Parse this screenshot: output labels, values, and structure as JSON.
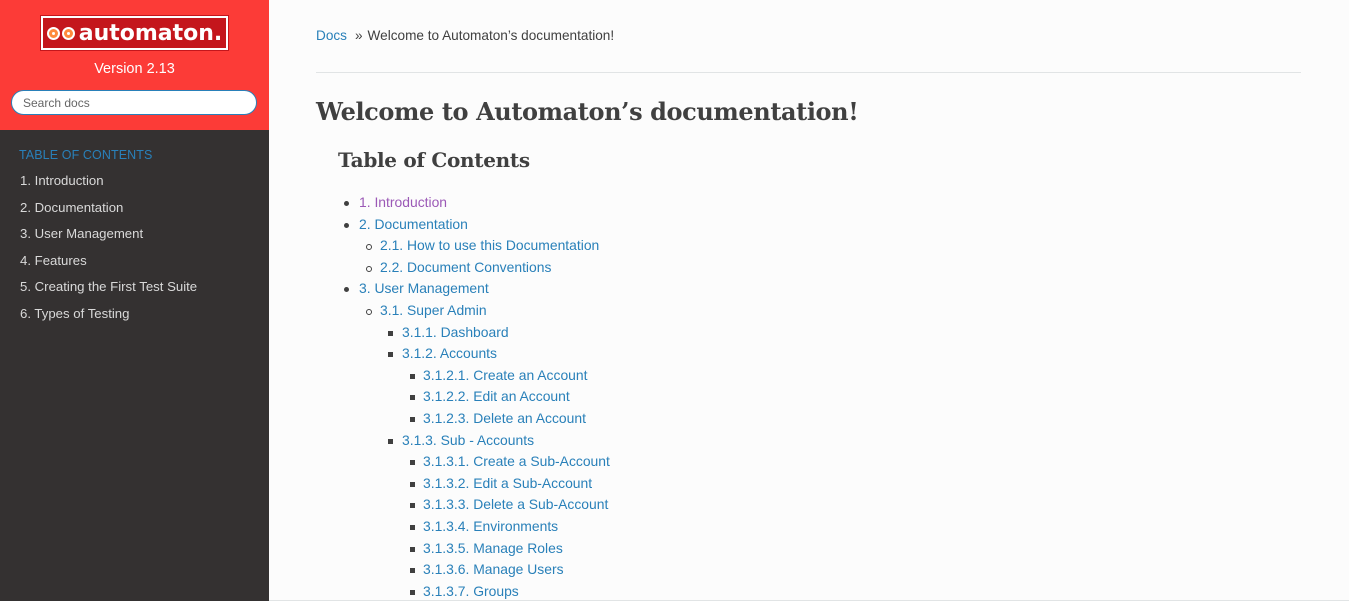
{
  "sidebar": {
    "logo_text": "automaton.",
    "version": "Version 2.13",
    "search_placeholder": "Search docs",
    "caption": "TABLE OF CONTENTS",
    "items": [
      {
        "label": "1. Introduction"
      },
      {
        "label": "2. Documentation"
      },
      {
        "label": "3. User Management"
      },
      {
        "label": "4. Features"
      },
      {
        "label": "5. Creating the First Test Suite"
      },
      {
        "label": "6. Types of Testing"
      }
    ]
  },
  "breadcrumb": {
    "home": "Docs",
    "separator": "»",
    "current": "Welcome to Automaton’s documentation!"
  },
  "page_title": "Welcome to Automaton’s documentation!",
  "toc_title": "Table of Contents",
  "toc": [
    {
      "label": "1. Introduction",
      "level": 1,
      "visited": true
    },
    {
      "label": "2. Documentation",
      "level": 1
    },
    {
      "label": "2.1. How to use this Documentation",
      "level": 2
    },
    {
      "label": "2.2. Document Conventions",
      "level": 2
    },
    {
      "label": "3. User Management",
      "level": 1
    },
    {
      "label": "3.1. Super Admin",
      "level": 2
    },
    {
      "label": "3.1.1. Dashboard",
      "level": 3
    },
    {
      "label": "3.1.2. Accounts",
      "level": 3
    },
    {
      "label": "3.1.2.1. Create an Account",
      "level": 4
    },
    {
      "label": "3.1.2.2. Edit an Account",
      "level": 4
    },
    {
      "label": "3.1.2.3. Delete an Account",
      "level": 4
    },
    {
      "label": "3.1.3. Sub - Accounts",
      "level": 3
    },
    {
      "label": "3.1.3.1. Create a Sub-Account",
      "level": 4
    },
    {
      "label": "3.1.3.2. Edit a Sub-Account",
      "level": 4
    },
    {
      "label": "3.1.3.3. Delete a Sub-Account",
      "level": 4
    },
    {
      "label": "3.1.3.4. Environments",
      "level": 4
    },
    {
      "label": "3.1.3.5. Manage Roles",
      "level": 4
    },
    {
      "label": "3.1.3.6. Manage Users",
      "level": 4
    },
    {
      "label": "3.1.3.7. Groups",
      "level": 4
    }
  ],
  "colors": {
    "brand_red": "#fc3b37",
    "sidebar_bg": "#343131",
    "link": "#2980b9",
    "visited_link": "#9b59b6"
  }
}
